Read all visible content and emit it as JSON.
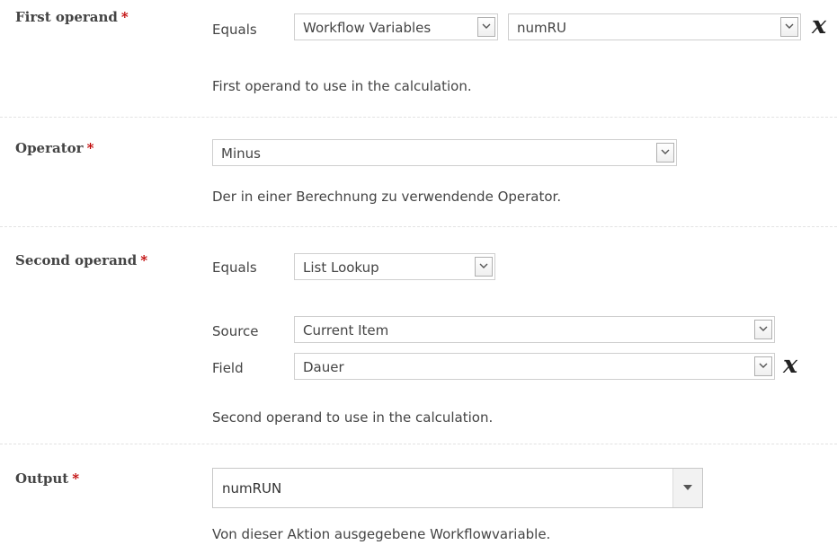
{
  "first_operand": {
    "label": "First operand",
    "required_mark": "*",
    "equals_label": "Equals",
    "source_value": "Workflow Variables",
    "variable_value": "numRU",
    "help_text": "First operand to use in the calculation."
  },
  "operator": {
    "label": "Operator",
    "required_mark": "*",
    "value": "Minus",
    "help_text": "Der in einer Berechnung zu verwendende Operator."
  },
  "second_operand": {
    "label": "Second operand",
    "required_mark": "*",
    "equals_label": "Equals",
    "equals_value": "List Lookup",
    "source_label": "Source",
    "source_value": "Current Item",
    "field_label": "Field",
    "field_value": "Dauer",
    "help_text": "Second operand to use in the calculation."
  },
  "output": {
    "label": "Output",
    "required_mark": "*",
    "value": "numRUN",
    "help_text": "Von dieser Aktion ausgegebene Workflowvariable."
  },
  "icons": {
    "clear": "x-function-icon",
    "dropdown": "chevron-down-icon"
  },
  "colors": {
    "required": "#bf0000",
    "text": "#444444",
    "border": "#cfcfcf"
  }
}
